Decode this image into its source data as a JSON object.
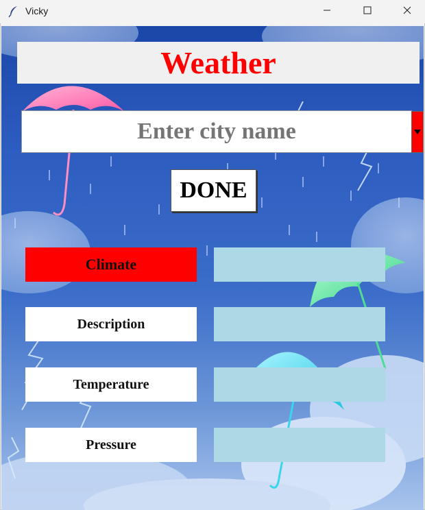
{
  "window": {
    "title": "Vicky",
    "icon": "feather-icon",
    "controls": [
      "minimize-icon",
      "maximize-icon",
      "close-icon"
    ]
  },
  "banner": {
    "title": "Weather"
  },
  "city": {
    "placeholder": "Enter city name",
    "value": ""
  },
  "done_label": "DONE",
  "fields": [
    {
      "label": "Climate",
      "value": ""
    },
    {
      "label": "Description",
      "value": ""
    },
    {
      "label": "Temperature",
      "value": ""
    },
    {
      "label": "Pressure",
      "value": ""
    }
  ],
  "colors": {
    "title": "#ff0000",
    "city_text": "#e0246e",
    "climate_bg": "#ff0000",
    "value_bg": "#add8e6",
    "dropdown_bg": "#ff0000"
  }
}
